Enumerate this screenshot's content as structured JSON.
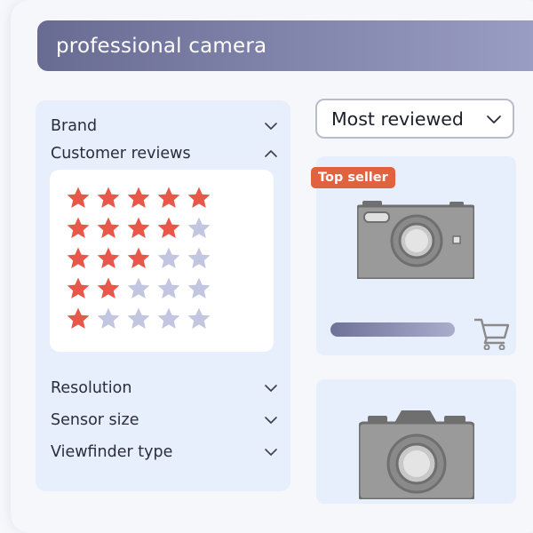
{
  "search": {
    "query": "professional camera"
  },
  "filters": {
    "items": [
      {
        "label": "Brand",
        "expanded": false
      },
      {
        "label": "Customer reviews",
        "expanded": true
      },
      {
        "label": "Resolution",
        "expanded": false
      },
      {
        "label": "Sensor size",
        "expanded": false
      },
      {
        "label": "Viewfinder type",
        "expanded": false
      }
    ],
    "rating_options": [
      5,
      4,
      3,
      2,
      1
    ],
    "rating_max": 5
  },
  "sort": {
    "selected": "Most reviewed"
  },
  "products": [
    {
      "badge": "Top seller",
      "icon": "camera-icon"
    },
    {
      "icon": "camera-icon"
    }
  ],
  "colors": {
    "star_filled": "#e8584a",
    "star_empty": "#c3c6e0",
    "badge": "#e0623f",
    "search_gradient_start": "#686b92",
    "search_gradient_end": "#9a9dc3",
    "panel": "#e7eefc"
  }
}
